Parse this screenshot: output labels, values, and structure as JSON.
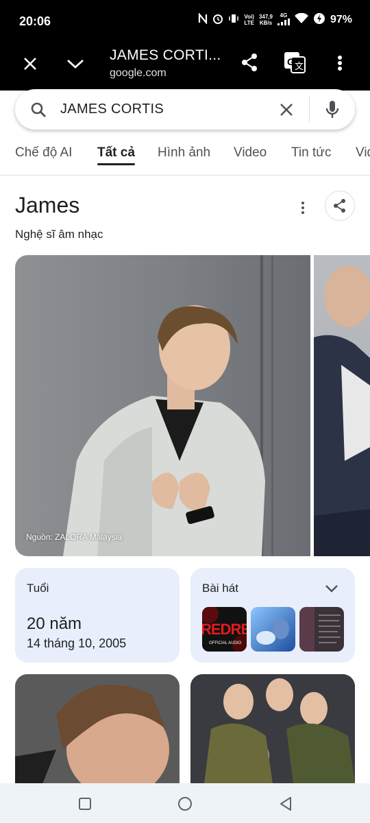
{
  "status_bar": {
    "time": "20:06",
    "net_line1": "347,9",
    "net_line2": "KB/s",
    "volte_line1": "Voi)",
    "volte_line2": "LTE",
    "signal_label": "4G",
    "battery": "97%"
  },
  "browser": {
    "title": "JAMES CORTI...",
    "domain": "google.com",
    "icons": [
      "close-icon",
      "chevron-down-icon",
      "share-icon",
      "translate-icon",
      "more-vert-icon"
    ]
  },
  "search": {
    "query": "JAMES CORTIS"
  },
  "tabs": [
    {
      "label": "Chế độ AI"
    },
    {
      "label": "Tất cả"
    },
    {
      "label": "Hình ảnh"
    },
    {
      "label": "Video"
    },
    {
      "label": "Tin tức"
    },
    {
      "label": "Vid"
    }
  ],
  "active_tab": "Tất cả",
  "knowledge_panel": {
    "title": "James",
    "subtitle": "Nghệ sĩ âm nhạc",
    "image_credit": "Nguồn: ZALORA Malaysia"
  },
  "age_card": {
    "label": "Tuổi",
    "value": "20 năm",
    "date": "14 tháng 10, 2005"
  },
  "songs_card": {
    "label": "Bài hát",
    "thumb1_text": "REDRE",
    "thumb1_caption": "OFFICIAL AUDIO"
  },
  "colors": {
    "accent_card": "#e8eefb",
    "top_bar": "#000000",
    "nav_bar": "#eef3f8"
  }
}
